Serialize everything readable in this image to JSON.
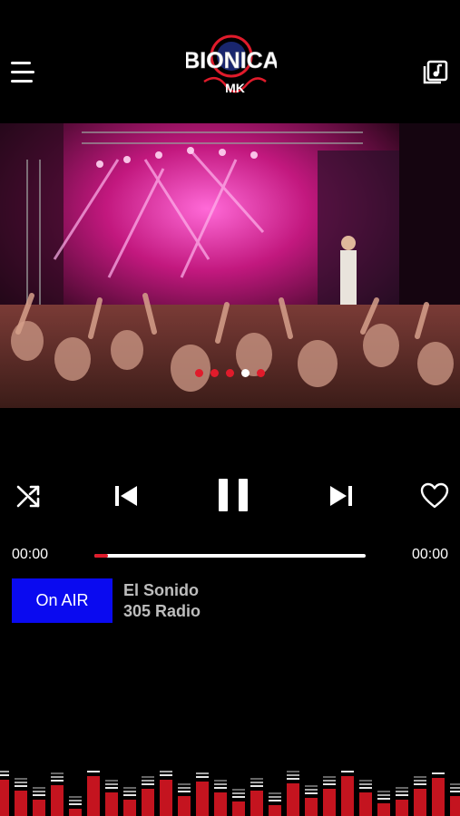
{
  "header": {
    "menu_icon": "hamburger-menu-icon",
    "playlist_icon": "music-playlist-icon",
    "logo_text": "BIONICA",
    "logo_subtext": "MK"
  },
  "banner": {
    "image": "concert-crowd-stage-lights",
    "slides": 5,
    "active_slide": 4
  },
  "controls": {
    "shuffle_icon": "shuffle-icon",
    "prev_icon": "skip-previous-icon",
    "play_state_icon": "pause-icon",
    "next_icon": "skip-next-icon",
    "favorite_icon": "heart-outline-icon"
  },
  "progress": {
    "elapsed": "00:00",
    "total": "00:00",
    "fraction": 0.05
  },
  "now_playing": {
    "on_air_label": "On AIR",
    "title": "El Sonido",
    "subtitle": "305 Radio"
  },
  "colors": {
    "accent": "#e01b2b",
    "on_air_bg": "#0a0af0",
    "background": "#000000"
  }
}
